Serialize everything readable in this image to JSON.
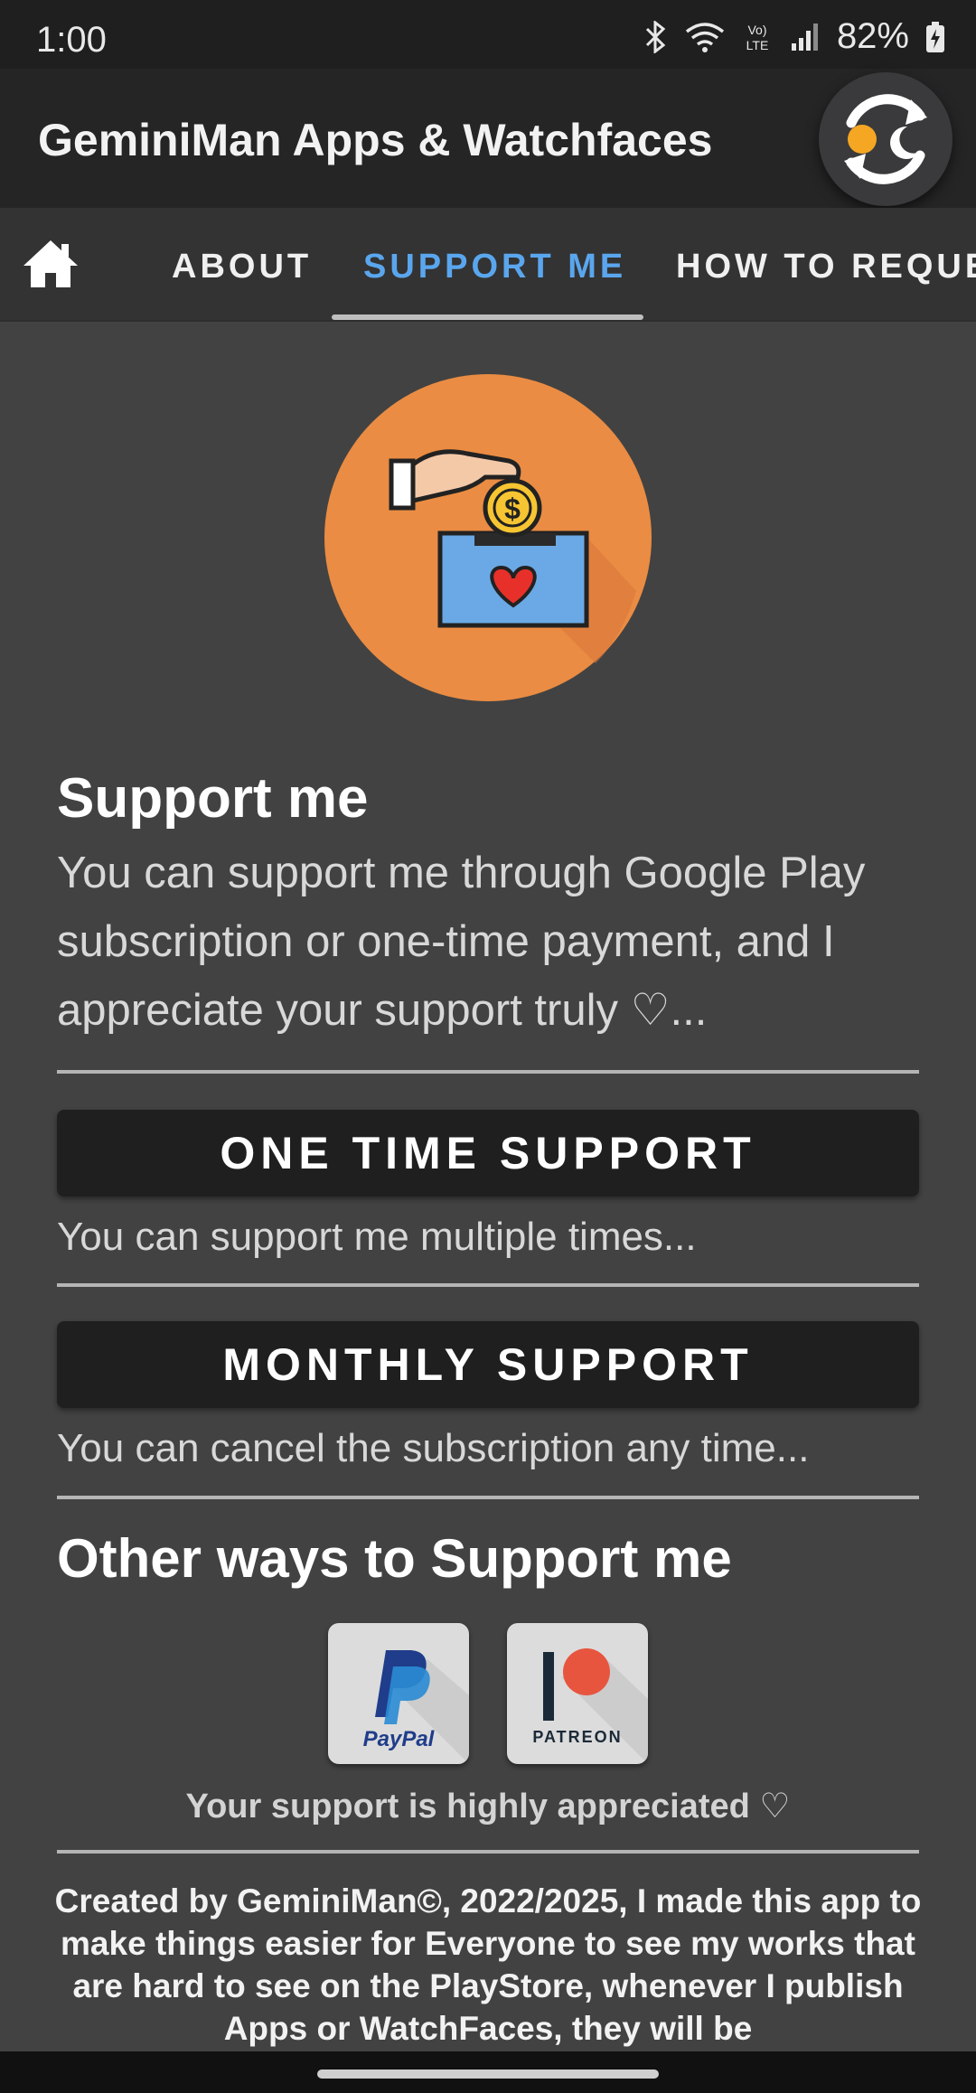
{
  "status_bar": {
    "time": "1:00",
    "battery": "82%",
    "icons": [
      "bluetooth-icon",
      "wifi-icon",
      "volte-icon",
      "signal-icon",
      "battery-charging-icon"
    ]
  },
  "app_bar": {
    "title": "GeminiMan Apps & Watchfaces",
    "action_icon": "refresh-icon"
  },
  "tabs": {
    "home_icon": "home-icon",
    "items": [
      {
        "label": "ABOUT"
      },
      {
        "label": "SUPPORT ME"
      },
      {
        "label": "HOW TO REQUEST"
      }
    ],
    "selected_color": "#5aa6ee"
  },
  "main": {
    "hero_icon": "donation-box-icon",
    "title": "Support me",
    "description": "You can support me through Google Play subscription or one-time payment, and I appreciate your support truly ♡...",
    "one_time": {
      "button": "ONE TIME SUPPORT",
      "note": "You can support me multiple times..."
    },
    "monthly": {
      "button": "MONTHLY SUPPORT",
      "note": "You can cancel the subscription any time..."
    },
    "other_title": "Other ways to Support me",
    "paypal_label": "PayPal",
    "patreon_label": "PATREON",
    "appreciate": "Your support is highly appreciated ♡",
    "footer": "Created by GeminiMan©, 2022/2025, I made this app to make things easier for Everyone to see my works that are hard to see on the PlayStore, whenever I publish Apps or WatchFaces, they will be"
  }
}
